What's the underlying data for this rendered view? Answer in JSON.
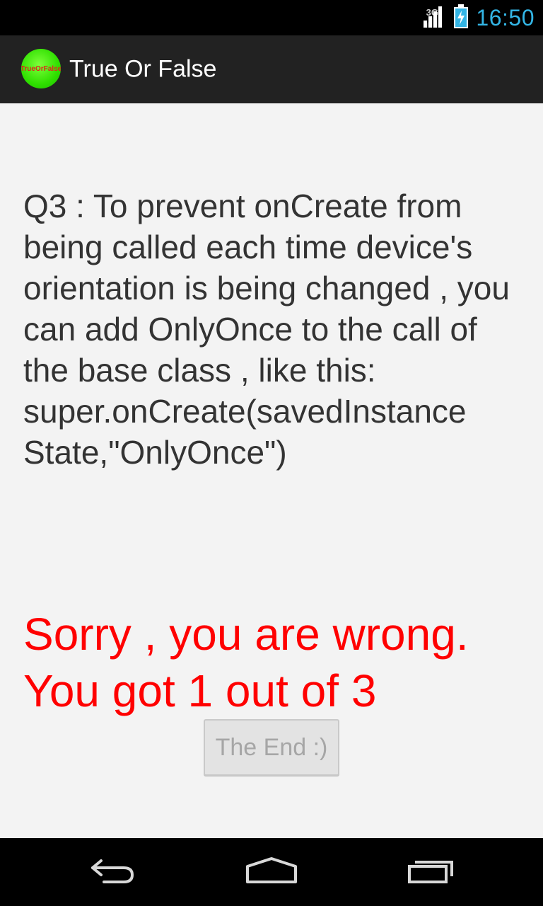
{
  "status_bar": {
    "network": "3G",
    "time": "16:50",
    "icons": [
      "signal-icon",
      "battery-charging-icon"
    ]
  },
  "action_bar": {
    "icon_text": "TrueOrFalse",
    "title": "True Or False"
  },
  "main": {
    "question": "Q3 : To prevent onCreate from being called each time device's orientation is being changed , you can add OnlyOnce to the call of the base class , like this: super.onCreate(savedInstance State,\"OnlyOnce\")",
    "result_line1": "Sorry , you are wrong.",
    "result_line2": "You got 1 out of 3",
    "end_button_label": "The End :)"
  },
  "nav_bar": {
    "icons": [
      "back-icon",
      "home-icon",
      "recent-apps-icon"
    ]
  },
  "colors": {
    "accent_clock": "#33b5e5",
    "result_text": "#ff0000",
    "action_bar_bg": "#222222",
    "content_bg": "#f3f3f3"
  }
}
